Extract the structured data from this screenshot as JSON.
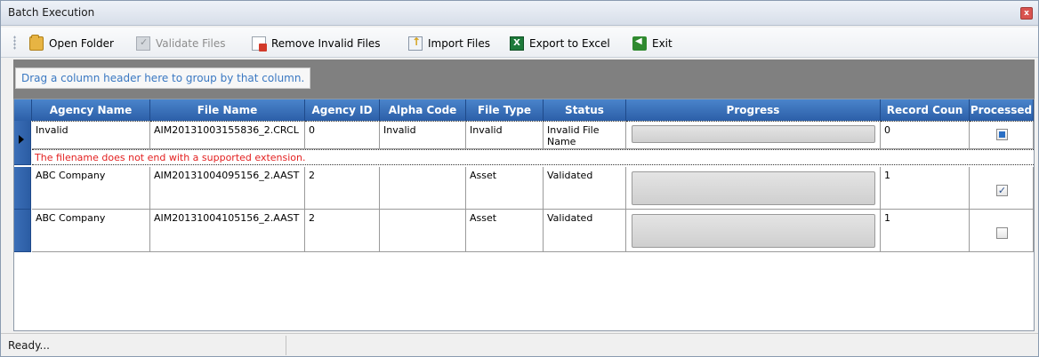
{
  "window": {
    "title": "Batch Execution",
    "close_glyph": "x"
  },
  "toolbar": {
    "items": [
      {
        "label": "Open Folder",
        "icon": "folder-icon",
        "enabled": true
      },
      {
        "label": "Validate Files",
        "icon": "validate-icon",
        "enabled": false
      },
      {
        "label": "Remove Invalid Files",
        "icon": "remove-icon",
        "enabled": true
      },
      {
        "label": "Import Files",
        "icon": "import-icon",
        "enabled": true
      },
      {
        "label": "Export to Excel",
        "icon": "excel-icon",
        "enabled": true
      },
      {
        "label": "Exit",
        "icon": "exit-icon",
        "enabled": true
      }
    ],
    "excel_glyph": "X"
  },
  "group_panel": {
    "hint": "Drag a column header here to group by that column."
  },
  "grid": {
    "columns": [
      "Agency Name",
      "File Name",
      "Agency ID",
      "Alpha Code",
      "File Type",
      "Status",
      "Progress",
      "Record Coun",
      "Processed"
    ],
    "rows": [
      {
        "agency_name": "Invalid",
        "file_name": "AIM20131003155836_2.CRCL",
        "agency_id": "0",
        "alpha_code": "Invalid",
        "file_type": "Invalid",
        "status": "Invalid File Name",
        "progress": 0,
        "record_count": "0",
        "processed": "indeterminate"
      },
      {
        "agency_name": "ABC Company",
        "file_name": "AIM20131004095156_2.AAST",
        "agency_id": "2",
        "alpha_code": "",
        "file_type": "Asset",
        "status": "Validated",
        "progress": 0,
        "record_count": "1",
        "processed": "checked"
      },
      {
        "agency_name": "ABC Company",
        "file_name": "AIM20131004105156_2.AAST",
        "agency_id": "2",
        "alpha_code": "",
        "file_type": "Asset",
        "status": "Validated",
        "progress": 0,
        "record_count": "1",
        "processed": "unchecked"
      }
    ],
    "error_message": "The filename does not end with a supported extension.",
    "checkbox_checked_glyph": "✓"
  },
  "status_bar": {
    "text": "Ready..."
  },
  "colors": {
    "header": "#2c5fa8",
    "error": "#e32020",
    "group_panel": "#808080",
    "hint_text": "#3a78c2"
  }
}
